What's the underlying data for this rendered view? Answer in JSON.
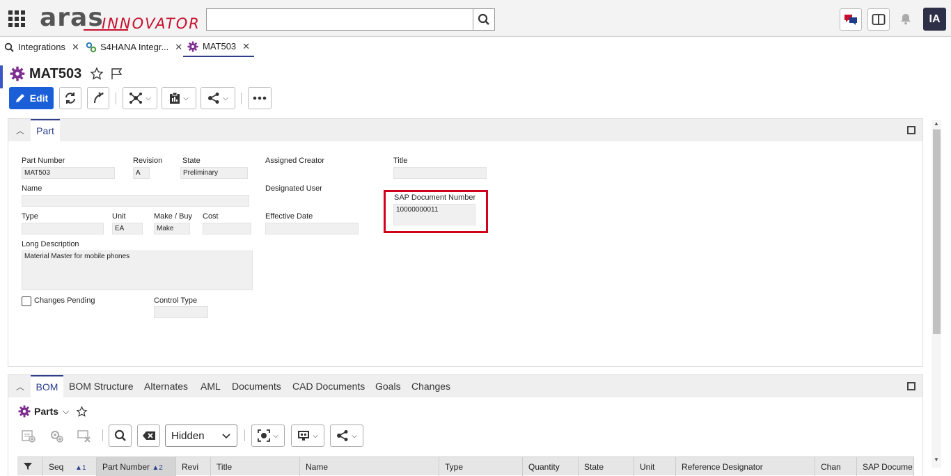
{
  "header": {
    "logo_main": "aras",
    "logo_sub": "INNOVATOR",
    "search_placeholder": "",
    "user_initials": "IA"
  },
  "tabs": [
    {
      "label": "Integrations"
    },
    {
      "label": "S4HANA Integr..."
    },
    {
      "label": "MAT503"
    }
  ],
  "item": {
    "title": "MAT503",
    "edit_label": "Edit"
  },
  "part_panel": {
    "tab_label": "Part",
    "fields": {
      "part_number": {
        "label": "Part Number",
        "value": "MAT503"
      },
      "revision": {
        "label": "Revision",
        "value": "A"
      },
      "state": {
        "label": "State",
        "value": "Preliminary"
      },
      "assigned_creator": {
        "label": "Assigned Creator",
        "value": ""
      },
      "title": {
        "label": "Title",
        "value": ""
      },
      "name": {
        "label": "Name",
        "value": ""
      },
      "designated_user": {
        "label": "Designated User",
        "value": ""
      },
      "sap_document_number": {
        "label": "SAP Document Number",
        "value": "10000000011"
      },
      "type": {
        "label": "Type",
        "value": ""
      },
      "unit": {
        "label": "Unit",
        "value": "EA"
      },
      "make_buy": {
        "label": "Make / Buy",
        "value": "Make"
      },
      "cost": {
        "label": "Cost",
        "value": ""
      },
      "effective_date": {
        "label": "Effective Date",
        "value": ""
      },
      "long_description": {
        "label": "Long Description",
        "value": "Material Master for mobile phones"
      },
      "changes_pending": {
        "label": "Changes Pending",
        "checked": false
      },
      "control_type": {
        "label": "Control Type",
        "value": ""
      }
    }
  },
  "relationships": {
    "tabs": [
      "BOM",
      "BOM Structure",
      "Alternates",
      "AML",
      "Documents",
      "CAD Documents",
      "Goals",
      "Changes"
    ],
    "active_tab": "BOM",
    "item_type_label": "Parts",
    "view_mode": "Hidden",
    "columns": [
      {
        "label": "Seq",
        "sort": "1"
      },
      {
        "label": "Part Number",
        "sort": "2"
      },
      {
        "label": "Revi"
      },
      {
        "label": "Title"
      },
      {
        "label": "Name"
      },
      {
        "label": "Type"
      },
      {
        "label": "Quantity"
      },
      {
        "label": "State"
      },
      {
        "label": "Unit"
      },
      {
        "label": "Reference Designator"
      },
      {
        "label": "Chan"
      },
      {
        "label": "SAP Docume"
      }
    ]
  },
  "colors": {
    "accent": "#1a5fd8",
    "brand_red": "#c8102e",
    "active_tab": "#2c3e8c",
    "highlight": "#d0021b",
    "gear_purple": "#7b2c8e"
  }
}
